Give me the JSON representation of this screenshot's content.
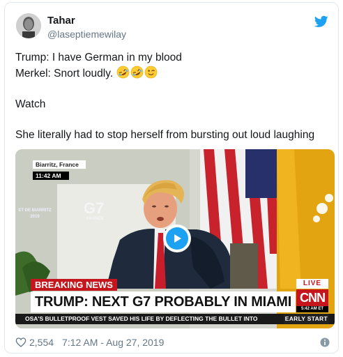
{
  "author": {
    "name": "Tahar",
    "handle": "@laseptiemewilay"
  },
  "tweet": {
    "line1": "Trump: I have German in my blood",
    "line2": "Merkel: Snort loudly.",
    "line2_emoji": [
      "rolling-on-floor-laughing",
      "rolling-on-floor-laughing",
      "winking-face"
    ],
    "line3": "Watch",
    "line4": "She literally had to stop herself from bursting out loud laughing"
  },
  "video": {
    "location": "Biarritz, France",
    "time": "11:42 AM",
    "backdrop_g7": "G7",
    "backdrop_g7_sub": "FRANCE",
    "backdrop_side": "ET DE BIARRITZ 2019",
    "breaking_label": "BREAKING NEWS",
    "headline": "TRUMP: NEXT G7 PROBABLY IN MIAMI",
    "live_label": "LIVE",
    "network": "CNN",
    "network_time": "5:42 AM ET",
    "ticker": "OSA'S BULLETPROOF VEST SAVED HIS LIFE BY DEFLECTING THE BULLET INTO",
    "ticker_tag": "EARLY START"
  },
  "footer": {
    "likes": "2,554",
    "timestamp": "7:12 AM - Aug 27, 2019"
  },
  "colors": {
    "twitter_blue": "#1da1f2",
    "cnn_red": "#c4161c",
    "muted_text": "#657786"
  }
}
